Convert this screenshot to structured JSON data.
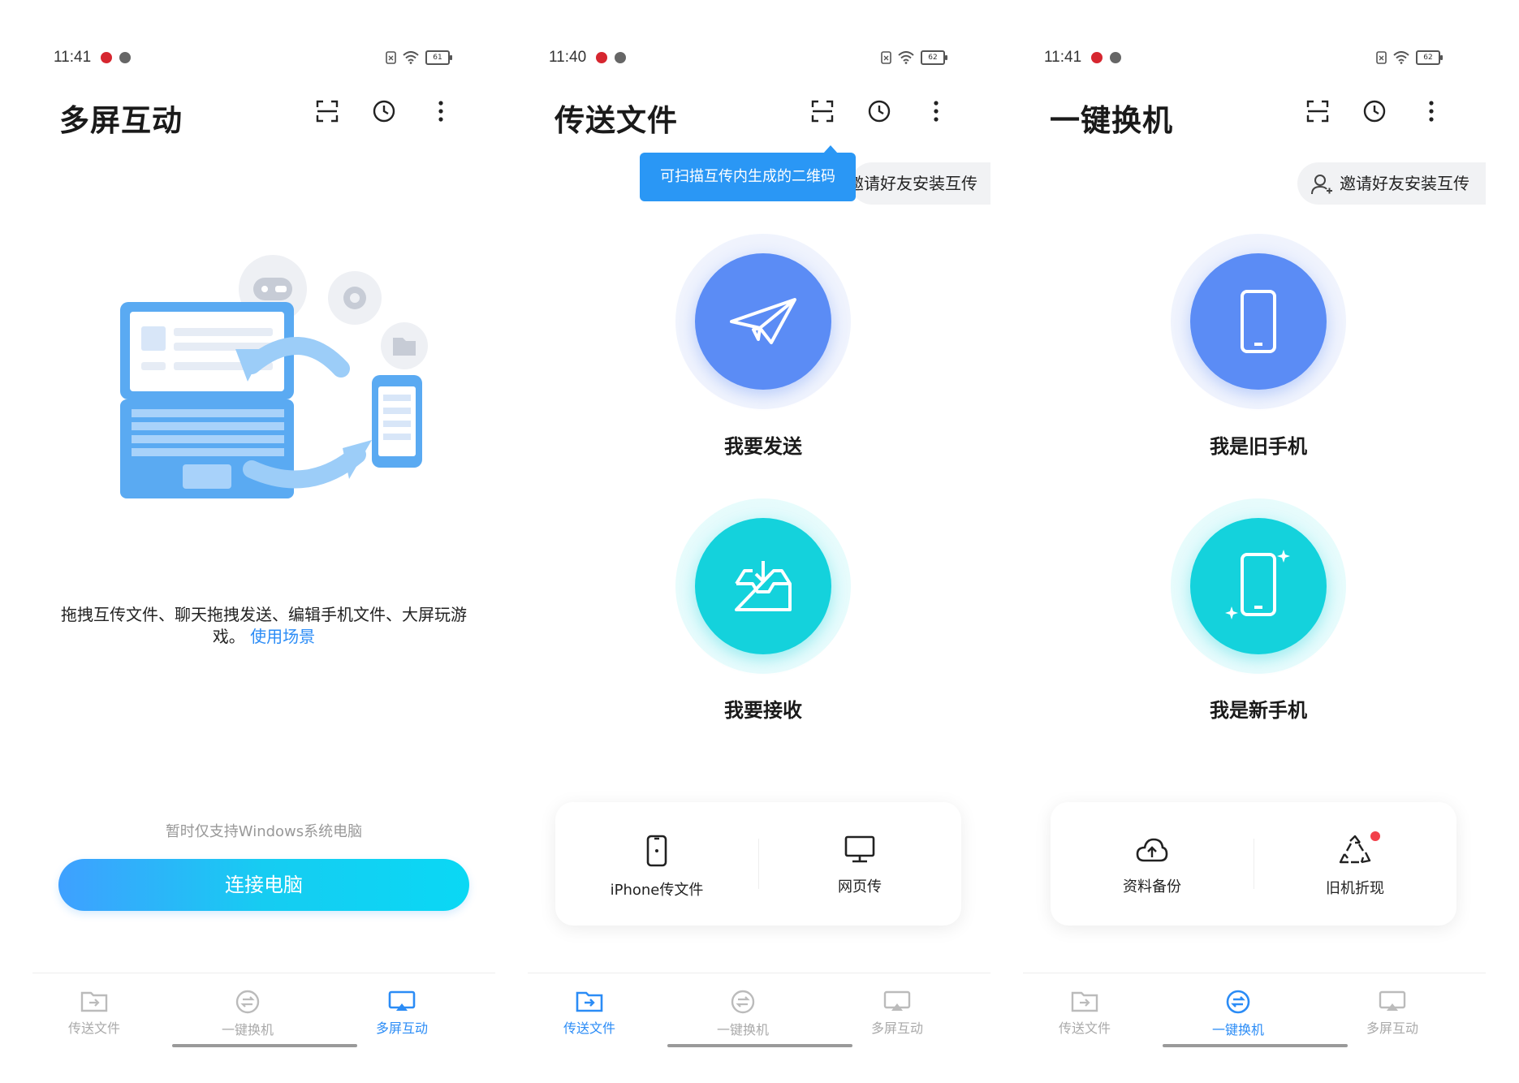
{
  "common": {
    "tabs": {
      "transfer": "传送文件",
      "switch": "一键换机",
      "multiscreen": "多屏互动"
    }
  },
  "panel1": {
    "time": "11:41",
    "battery": "61",
    "title": "多屏互动",
    "description": "拖拽互传文件、聊天拖拽发送、编辑手机文件、大屏玩游戏。",
    "link": "使用场景",
    "note": "暂时仅支持Windows系统电脑",
    "button": "连接电脑",
    "active_tab": "multiscreen"
  },
  "panel2": {
    "time": "11:40",
    "battery": "62",
    "title": "传送文件",
    "tooltip": "可扫描互传内生成的二维码",
    "invite": "邀请好友安装互传",
    "send": "我要发送",
    "receive": "我要接收",
    "card": [
      "iPhone传文件",
      "网页传"
    ],
    "active_tab": "transfer"
  },
  "panel3": {
    "time": "11:41",
    "battery": "62",
    "title": "一键换机",
    "invite": "邀请好友安装互传",
    "old_phone": "我是旧手机",
    "new_phone": "我是新手机",
    "card": [
      "资料备份",
      "旧机折现"
    ],
    "active_tab": "switch"
  },
  "colors": {
    "accent": "#2b8cf6",
    "send_blue": "#5b8cf5",
    "receive_cyan": "#14d2dc",
    "badge_red": "#f2404a"
  }
}
